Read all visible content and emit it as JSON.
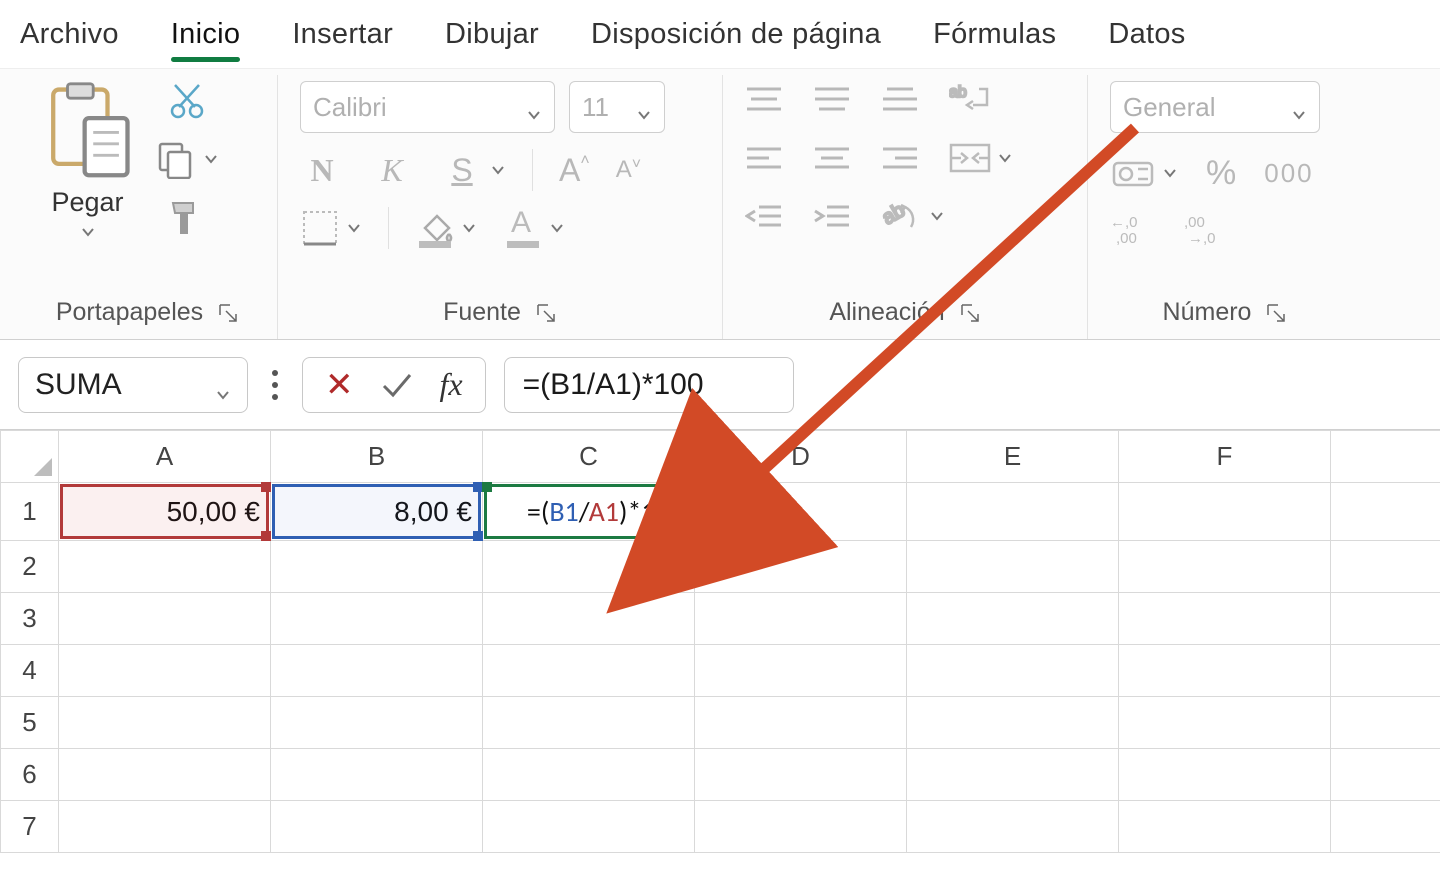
{
  "tabs": {
    "file": "Archivo",
    "home": "Inicio",
    "insert": "Insertar",
    "draw": "Dibujar",
    "layout": "Disposición de página",
    "formulas": "Fórmulas",
    "data": "Datos",
    "active": "home"
  },
  "ribbon": {
    "clipboard": {
      "paste": "Pegar",
      "group": "Portapapeles"
    },
    "font": {
      "name_placeholder": "Calibri",
      "size_placeholder": "11",
      "bold": "N",
      "italic": "K",
      "underline": "S",
      "group": "Fuente"
    },
    "alignment": {
      "group": "Alineación"
    },
    "number": {
      "format_placeholder": "General",
      "zeros": "000",
      "inc_dec_left": "←,0",
      "inc_dec_right": ",00→",
      "group": "Número"
    }
  },
  "formula_bar": {
    "name_box": "SUMA",
    "fx_label": "fx",
    "formula": "=(B1/A1)*100"
  },
  "grid": {
    "columns": [
      "A",
      "B",
      "C",
      "D",
      "E",
      "F"
    ],
    "rows": [
      "1",
      "2",
      "3",
      "4",
      "5",
      "6",
      "7"
    ],
    "active_cell": "C1",
    "cells": {
      "A1": "50,00 €",
      "B1": "8,00 €",
      "C1_parts": {
        "pre": "=(",
        "b1": "B1",
        "mid": "/",
        "a1": "A1",
        "post": ")*100"
      }
    }
  }
}
